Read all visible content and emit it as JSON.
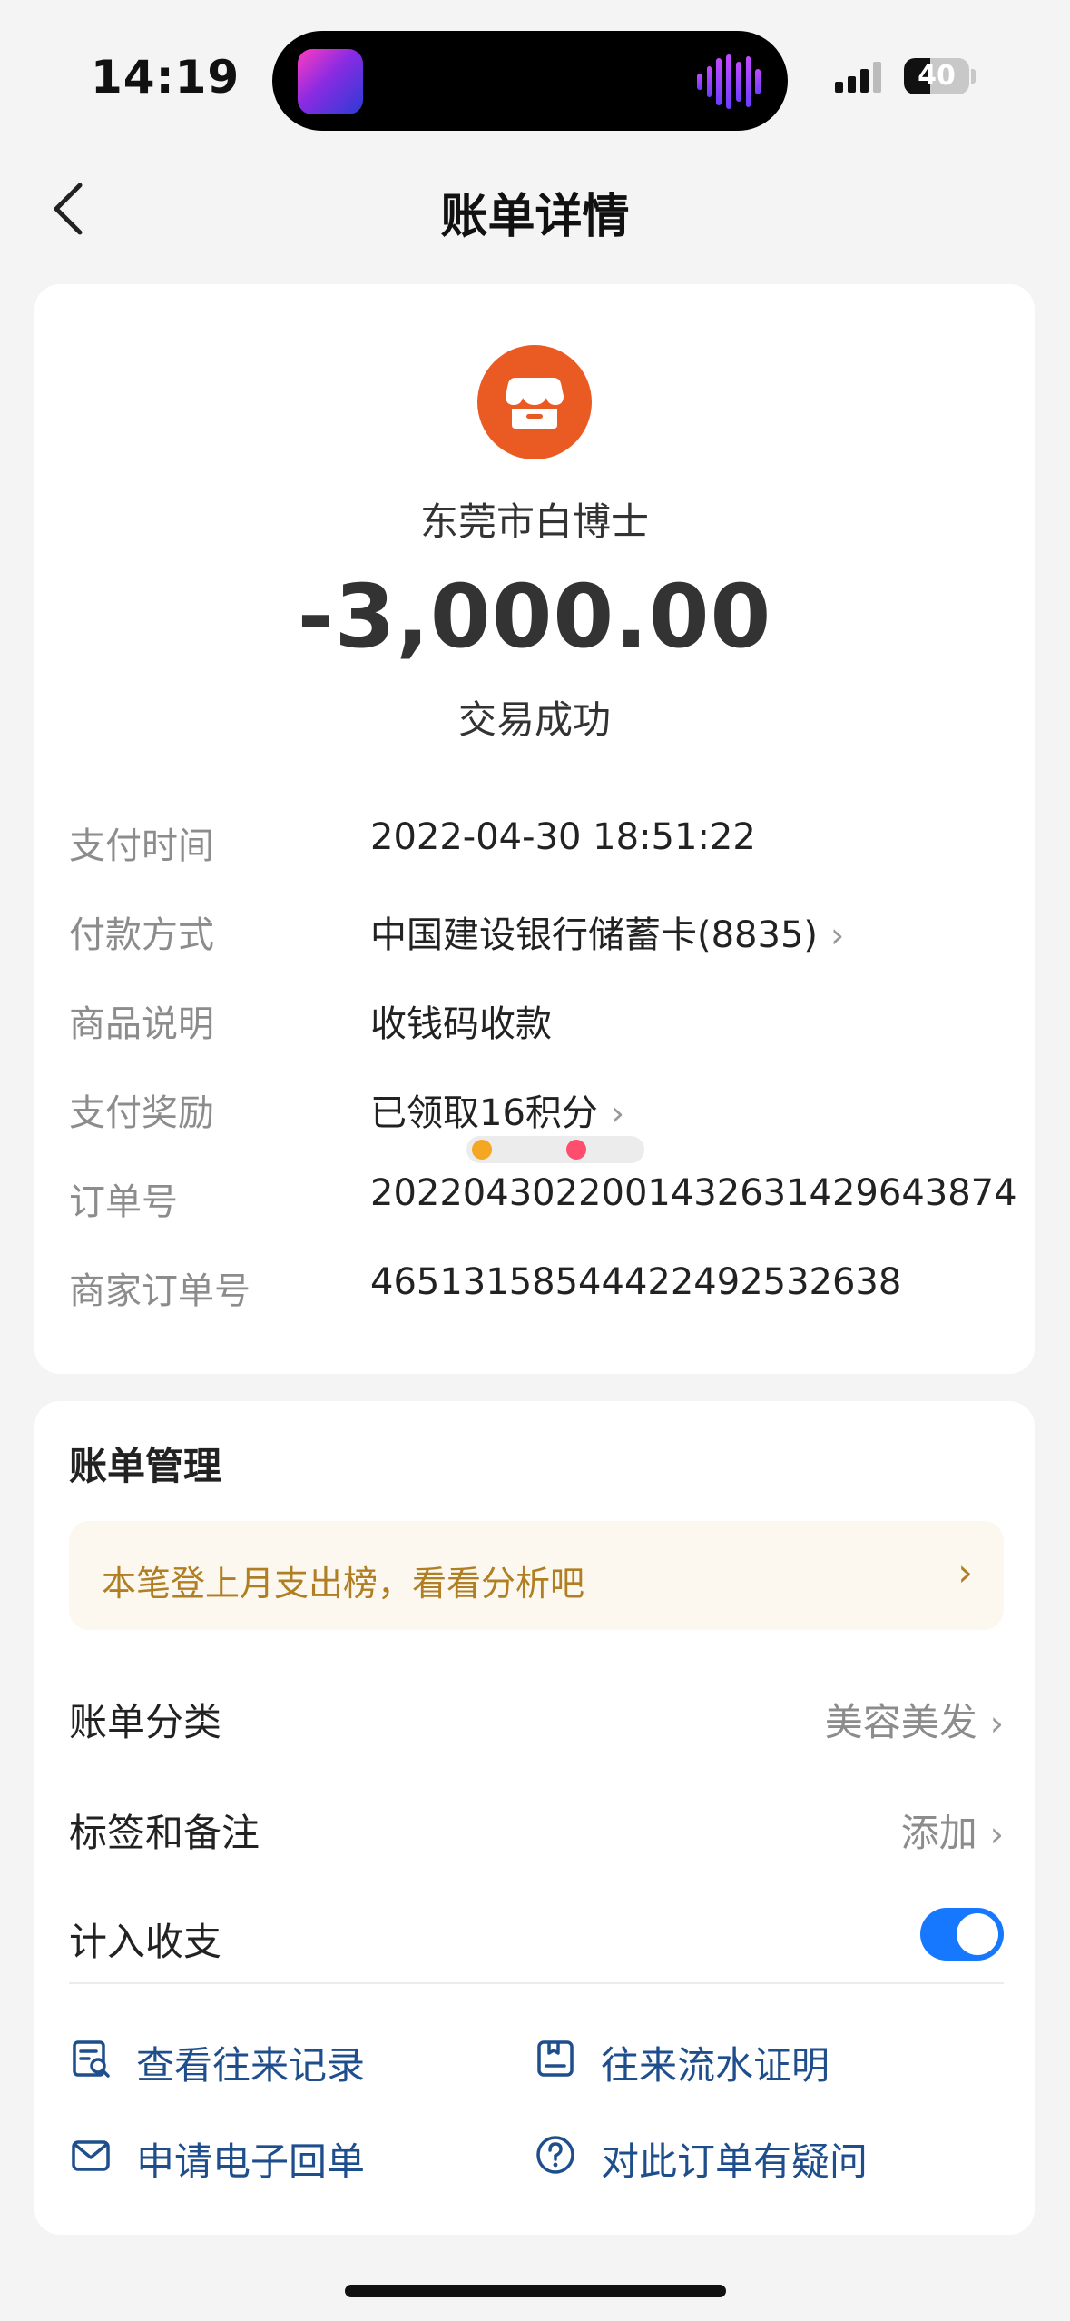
{
  "status_bar": {
    "time": "14:19",
    "battery": "40",
    "battery_level": 0.4
  },
  "nav": {
    "title": "账单详情",
    "back_icon": "chevron-left-icon"
  },
  "summary": {
    "merchant_icon": "store-icon",
    "merchant_name": "东莞市白博士",
    "amount": "-3,000.00",
    "status": "交易成功",
    "accent_color": "#ea5a23"
  },
  "details": [
    {
      "label": "支付时间",
      "value": "2022-04-30 18:51:22",
      "link": false
    },
    {
      "label": "付款方式",
      "value": "中国建设银行储蓄卡(8835)",
      "link": true
    },
    {
      "label": "商品说明",
      "value": "收钱码收款",
      "link": false
    },
    {
      "label": "支付奖励",
      "value": "已领取16积分",
      "link": true
    },
    {
      "label": "订单号",
      "value": "2022043022001432631429643874",
      "link": false
    },
    {
      "label": "商家订单号",
      "value": "46513158544422492532638",
      "link": false
    }
  ],
  "management": {
    "title": "账单管理",
    "banner": "本笔登上月支出榜，看看分析吧",
    "category_label": "账单分类",
    "category_value": "美容美发",
    "tags_label": "标签和备注",
    "tags_value": "添加",
    "include_label": "计入收支",
    "include_enabled": true,
    "toggle_color": "#1677ff"
  },
  "actions": [
    {
      "label": "查看往来记录",
      "icon": "record-search-icon"
    },
    {
      "label": "往来流水证明",
      "icon": "statement-icon"
    },
    {
      "label": "申请电子回单",
      "icon": "mail-icon"
    },
    {
      "label": "对此订单有疑问",
      "icon": "question-icon"
    }
  ]
}
